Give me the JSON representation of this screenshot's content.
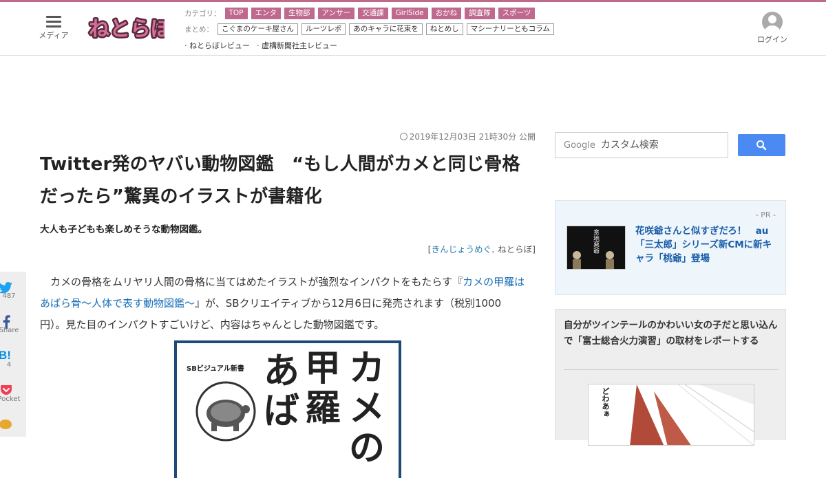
{
  "header": {
    "menu_label": "メディア",
    "logo_text": "ねとらぼ",
    "category_label": "カテゴリ：",
    "categories": [
      "TOP",
      "エンタ",
      "生物部",
      "アンサー",
      "交通課",
      "GirlSide",
      "おかね",
      "調査隊",
      "スポーツ"
    ],
    "matome_label": "まとめ：",
    "matome": [
      "こぐまのケーキ屋さん",
      "ルーツレポ",
      "あのキャラに花束を",
      "ねとめし",
      "マシーナリーともコラム"
    ],
    "extra_links": [
      "· ねとらぼレビュー",
      "· 虚構新聞社主レビュー"
    ],
    "login_label": "ログイン"
  },
  "article": {
    "published": "2019年12月03日 21時30分 公開",
    "title": "Twitter発のヤバい動物図鑑　“もし人間がカメと同じ骨格だったら”驚異のイラストが書籍化",
    "subtitle": "大人も子どもも楽しめそうな動物図鑑。",
    "byline_open": "[",
    "author": "きんじょうめぐ",
    "byline_sep": "，",
    "site": "ねとらぼ",
    "byline_close": "]",
    "body_before": "　カメの骨格をムリヤリ人間の骨格に当てはめたイラストが強烈なインパクトをもたらす『",
    "body_link": "カメの甲羅はあばら骨～人体で表す動物図鑑～",
    "body_after": "』が、SBクリエイティブから12月6日に発売されます（税別1000円）。見た目のインパクトすごいけど、内容はちゃんとした動物図鑑です。",
    "cover_series": "SBビジュアル新書",
    "cover_title_col1": "カメの",
    "cover_title_col2": "甲羅",
    "cover_title_col3": "あば"
  },
  "share": {
    "twitter_count": "487",
    "facebook_label": "Share",
    "hatena_icon_text": "B!",
    "hatena_count": "4",
    "pocket_label": "Pocket"
  },
  "sidebar": {
    "search_brand": "Google",
    "search_placeholder": "カスタム検索",
    "pr_label": "- PR -",
    "pr_title": "花咲爺さんと似すぎだろ！　au「三太郎」シリーズ新CMに新キャラ「桃爺」登場",
    "pr_thumb_text": "意地悪爺",
    "card_title": "自分がツインテールのかわいい女の子だと思い込んで「富士総合火力演習」の取材をレポートする",
    "card_img_text": "どわあぁ"
  },
  "colors": {
    "accent": "#c0698f",
    "link": "#1a6fb8",
    "search_button": "#4b8af2"
  }
}
